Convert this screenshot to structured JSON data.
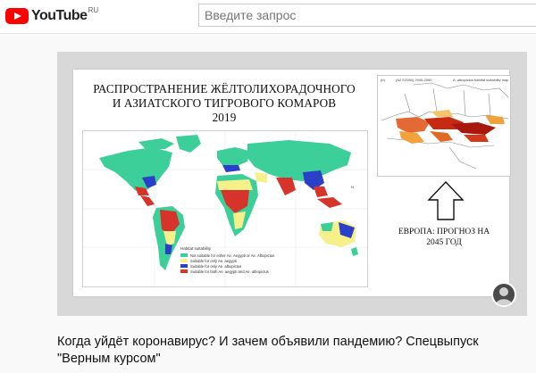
{
  "masthead": {
    "logo_text": "YouTube",
    "logo_region": "RU",
    "search_placeholder": "Введите запрос",
    "brand_color": "#ff0000"
  },
  "slide": {
    "title_line1": "РАСПРОСТРАНЕНИЕ ЖЁЛТОЛИХОРАДОЧНОГО",
    "title_line2": "И АЗИАТСКОГО ТИГРОВОГО КОМАРОВ",
    "year": "2019",
    "panel_b": "(b)",
    "map_compass": "N",
    "inset_title": "(A2 E2050) 2045-2050",
    "inset_legend": "A. albopictus habitat suitability map",
    "europe_line1": "ЕВРОПА: ПРОГНОЗ НА",
    "europe_line2": "2045 ГОД",
    "legend": {
      "title": "Habitat suitability",
      "items": [
        {
          "label": "Not suitable for either Ae. Aegypti or Ae. Albopictus",
          "color": "#3ccf9a"
        },
        {
          "label": "Suitable for only  Ae. aegypti",
          "color": "#f5f08a"
        },
        {
          "label": "Suitable for only  Ae. albopictus",
          "color": "#2b3fc8"
        },
        {
          "label": "Suitable for both  Ae. aegypti and Ae. albopictus",
          "color": "#d6342a"
        }
      ]
    }
  },
  "video": {
    "title": "Когда уйдёт коронавирус? И зачем объявили пандемию? Спецвыпуск \"Верным курсом\""
  }
}
